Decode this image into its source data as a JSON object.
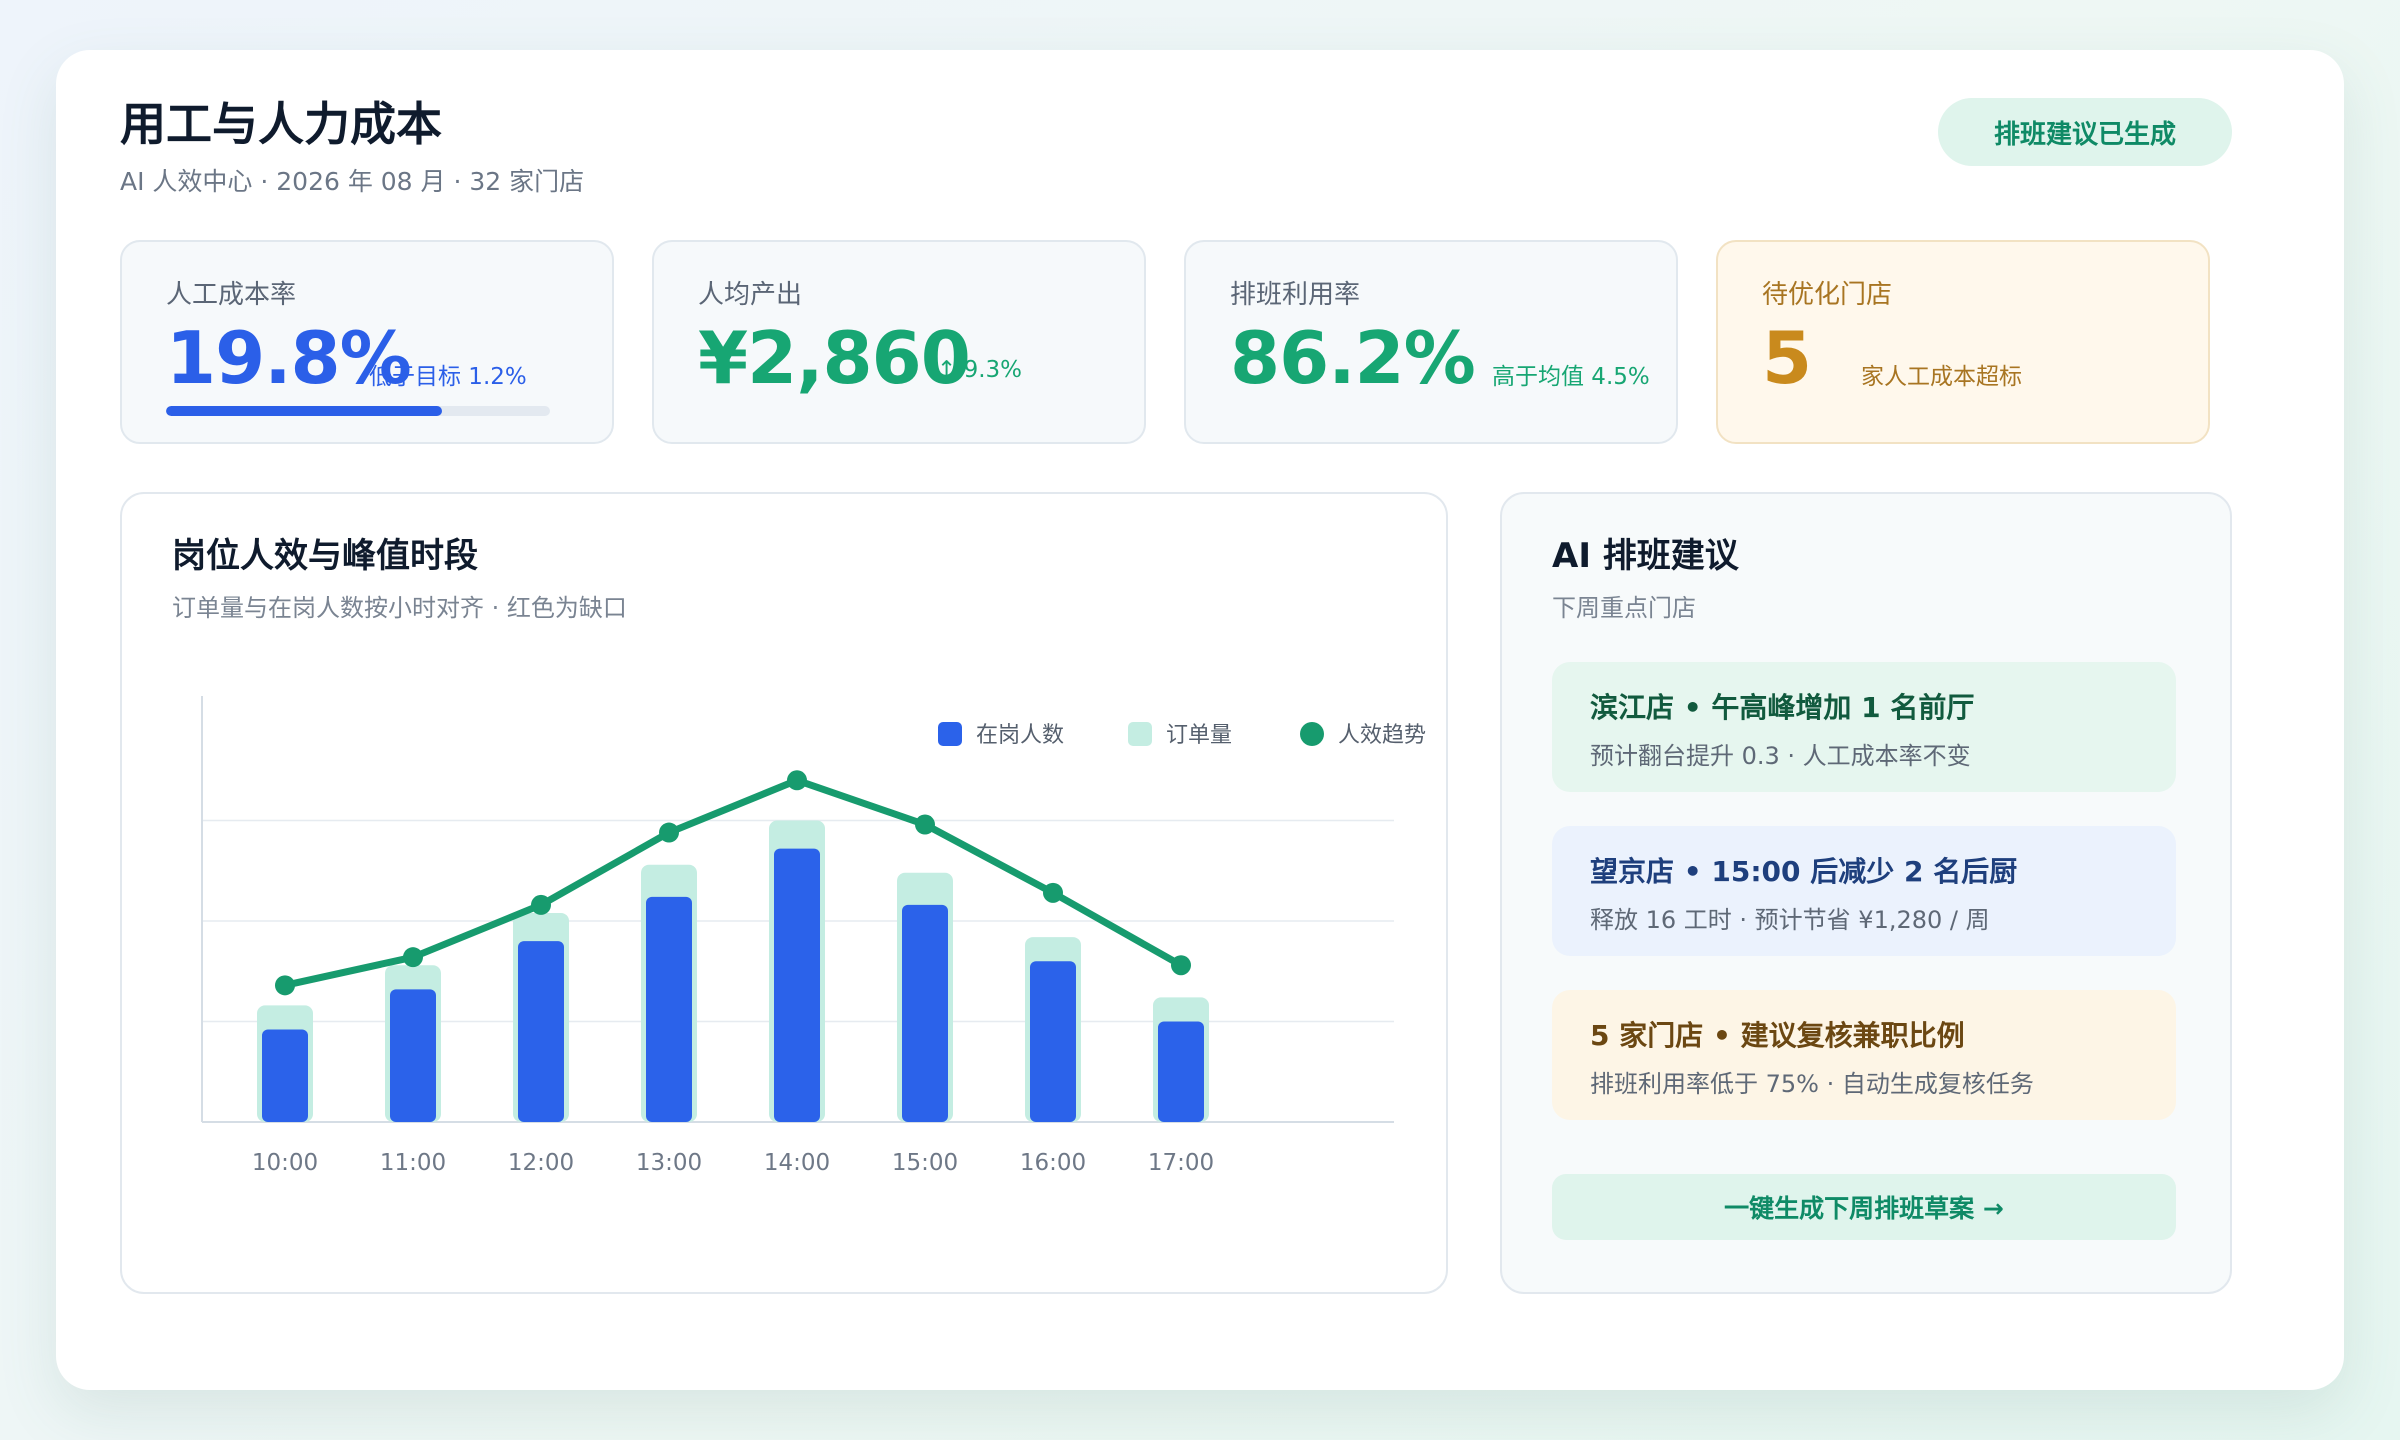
{
  "header": {
    "title": "用工与人力成本",
    "subtitle": "AI 人效中心 · 2026 年 08 月 · 32 家门店",
    "status_pill": "排班建议已生成"
  },
  "kpis": [
    {
      "label": "人工成本率",
      "value": "19.8%",
      "note": "低于目标 1.2%",
      "progress": 0.72,
      "value_color": "#2b5fe8"
    },
    {
      "label": "人均产出",
      "value": "¥2,860",
      "trend_arrow": "↑",
      "note": "9.3%",
      "value_color": "#17a673"
    },
    {
      "label": "排班利用率",
      "value": "86.2%",
      "note": "高于均值 4.5%",
      "value_color": "#17a673"
    },
    {
      "label": "待优化门店",
      "value": "5",
      "note": "家人工成本超标",
      "value_color": "#c98a1d"
    }
  ],
  "chart_panel": {
    "title": "岗位人效与峰值时段",
    "subtitle": "订单量与在岗人数按小时对齐 · 红色为缺口"
  },
  "chart_data": {
    "type": "bar",
    "categories": [
      "10:00",
      "11:00",
      "12:00",
      "13:00",
      "14:00",
      "15:00",
      "16:00",
      "17:00"
    ],
    "series": [
      {
        "name": "在岗人数",
        "kind": "bar",
        "color": "#2b62ea",
        "values": [
          23,
          33,
          45,
          56,
          68,
          54,
          40,
          25
        ]
      },
      {
        "name": "订单量",
        "kind": "bar-back",
        "color": "#c4ede2",
        "values": [
          29,
          39,
          52,
          64,
          75,
          62,
          46,
          31
        ]
      },
      {
        "name": "人效趋势",
        "kind": "line",
        "color": "#179b6e",
        "values": [
          34,
          41,
          54,
          72,
          85,
          74,
          57,
          39
        ]
      }
    ],
    "ylim": [
      0,
      100
    ],
    "grid": true,
    "legend": "top-right"
  },
  "ai_panel": {
    "title": "AI 排班建议",
    "subtitle": "下周重点门店",
    "suggestions": [
      {
        "title": "滨江店 • 午高峰增加 1 名前厅",
        "detail": "预计翻台提升 0.3 · 人工成本率不变",
        "bg": "#e6f6ef",
        "fg": "#115a3e"
      },
      {
        "title": "望京店 • 15:00 后减少 2 名后厨",
        "detail": "释放 16 工时 · 预计节省 ¥1,280 / 周",
        "bg": "#ebf2fd",
        "fg": "#1e3f7d"
      },
      {
        "title": "5 家门店 • 建议复核兼职比例",
        "detail": "排班利用率低于 75% · 自动生成复核任务",
        "bg": "#fdf5e6",
        "fg": "#6b4712"
      }
    ],
    "cta_label": "一键生成下周排班草案 →"
  }
}
